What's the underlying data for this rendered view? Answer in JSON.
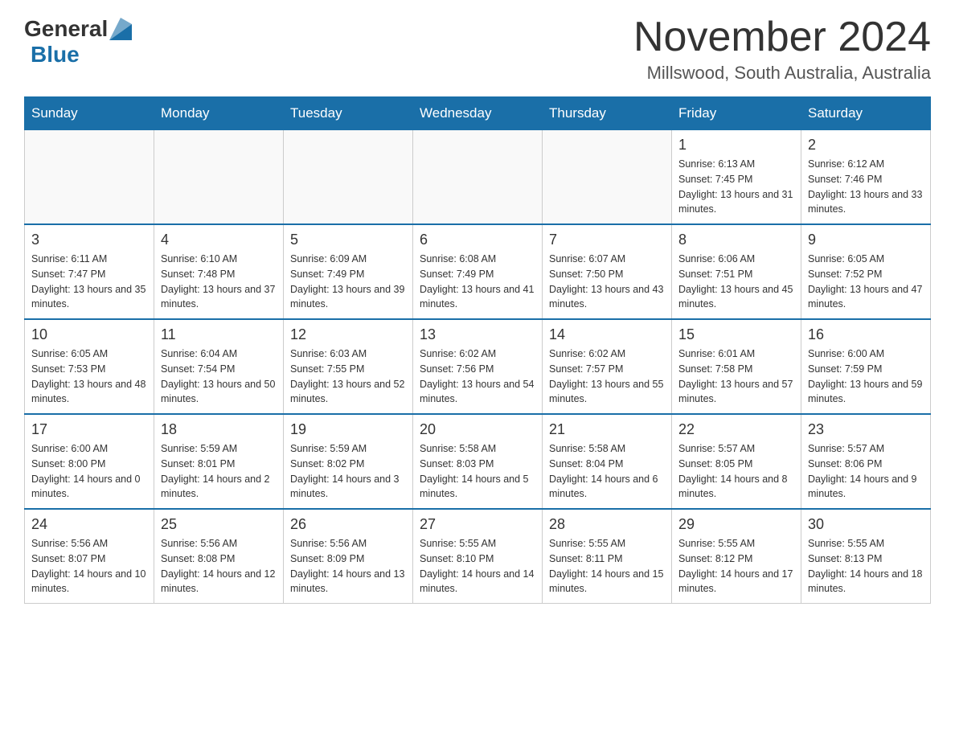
{
  "header": {
    "logo_general": "General",
    "logo_blue": "Blue",
    "month_title": "November 2024",
    "location": "Millswood, South Australia, Australia"
  },
  "weekdays": [
    "Sunday",
    "Monday",
    "Tuesday",
    "Wednesday",
    "Thursday",
    "Friday",
    "Saturday"
  ],
  "weeks": [
    [
      {
        "day": "",
        "sunrise": "",
        "sunset": "",
        "daylight": ""
      },
      {
        "day": "",
        "sunrise": "",
        "sunset": "",
        "daylight": ""
      },
      {
        "day": "",
        "sunrise": "",
        "sunset": "",
        "daylight": ""
      },
      {
        "day": "",
        "sunrise": "",
        "sunset": "",
        "daylight": ""
      },
      {
        "day": "",
        "sunrise": "",
        "sunset": "",
        "daylight": ""
      },
      {
        "day": "1",
        "sunrise": "Sunrise: 6:13 AM",
        "sunset": "Sunset: 7:45 PM",
        "daylight": "Daylight: 13 hours and 31 minutes."
      },
      {
        "day": "2",
        "sunrise": "Sunrise: 6:12 AM",
        "sunset": "Sunset: 7:46 PM",
        "daylight": "Daylight: 13 hours and 33 minutes."
      }
    ],
    [
      {
        "day": "3",
        "sunrise": "Sunrise: 6:11 AM",
        "sunset": "Sunset: 7:47 PM",
        "daylight": "Daylight: 13 hours and 35 minutes."
      },
      {
        "day": "4",
        "sunrise": "Sunrise: 6:10 AM",
        "sunset": "Sunset: 7:48 PM",
        "daylight": "Daylight: 13 hours and 37 minutes."
      },
      {
        "day": "5",
        "sunrise": "Sunrise: 6:09 AM",
        "sunset": "Sunset: 7:49 PM",
        "daylight": "Daylight: 13 hours and 39 minutes."
      },
      {
        "day": "6",
        "sunrise": "Sunrise: 6:08 AM",
        "sunset": "Sunset: 7:49 PM",
        "daylight": "Daylight: 13 hours and 41 minutes."
      },
      {
        "day": "7",
        "sunrise": "Sunrise: 6:07 AM",
        "sunset": "Sunset: 7:50 PM",
        "daylight": "Daylight: 13 hours and 43 minutes."
      },
      {
        "day": "8",
        "sunrise": "Sunrise: 6:06 AM",
        "sunset": "Sunset: 7:51 PM",
        "daylight": "Daylight: 13 hours and 45 minutes."
      },
      {
        "day": "9",
        "sunrise": "Sunrise: 6:05 AM",
        "sunset": "Sunset: 7:52 PM",
        "daylight": "Daylight: 13 hours and 47 minutes."
      }
    ],
    [
      {
        "day": "10",
        "sunrise": "Sunrise: 6:05 AM",
        "sunset": "Sunset: 7:53 PM",
        "daylight": "Daylight: 13 hours and 48 minutes."
      },
      {
        "day": "11",
        "sunrise": "Sunrise: 6:04 AM",
        "sunset": "Sunset: 7:54 PM",
        "daylight": "Daylight: 13 hours and 50 minutes."
      },
      {
        "day": "12",
        "sunrise": "Sunrise: 6:03 AM",
        "sunset": "Sunset: 7:55 PM",
        "daylight": "Daylight: 13 hours and 52 minutes."
      },
      {
        "day": "13",
        "sunrise": "Sunrise: 6:02 AM",
        "sunset": "Sunset: 7:56 PM",
        "daylight": "Daylight: 13 hours and 54 minutes."
      },
      {
        "day": "14",
        "sunrise": "Sunrise: 6:02 AM",
        "sunset": "Sunset: 7:57 PM",
        "daylight": "Daylight: 13 hours and 55 minutes."
      },
      {
        "day": "15",
        "sunrise": "Sunrise: 6:01 AM",
        "sunset": "Sunset: 7:58 PM",
        "daylight": "Daylight: 13 hours and 57 minutes."
      },
      {
        "day": "16",
        "sunrise": "Sunrise: 6:00 AM",
        "sunset": "Sunset: 7:59 PM",
        "daylight": "Daylight: 13 hours and 59 minutes."
      }
    ],
    [
      {
        "day": "17",
        "sunrise": "Sunrise: 6:00 AM",
        "sunset": "Sunset: 8:00 PM",
        "daylight": "Daylight: 14 hours and 0 minutes."
      },
      {
        "day": "18",
        "sunrise": "Sunrise: 5:59 AM",
        "sunset": "Sunset: 8:01 PM",
        "daylight": "Daylight: 14 hours and 2 minutes."
      },
      {
        "day": "19",
        "sunrise": "Sunrise: 5:59 AM",
        "sunset": "Sunset: 8:02 PM",
        "daylight": "Daylight: 14 hours and 3 minutes."
      },
      {
        "day": "20",
        "sunrise": "Sunrise: 5:58 AM",
        "sunset": "Sunset: 8:03 PM",
        "daylight": "Daylight: 14 hours and 5 minutes."
      },
      {
        "day": "21",
        "sunrise": "Sunrise: 5:58 AM",
        "sunset": "Sunset: 8:04 PM",
        "daylight": "Daylight: 14 hours and 6 minutes."
      },
      {
        "day": "22",
        "sunrise": "Sunrise: 5:57 AM",
        "sunset": "Sunset: 8:05 PM",
        "daylight": "Daylight: 14 hours and 8 minutes."
      },
      {
        "day": "23",
        "sunrise": "Sunrise: 5:57 AM",
        "sunset": "Sunset: 8:06 PM",
        "daylight": "Daylight: 14 hours and 9 minutes."
      }
    ],
    [
      {
        "day": "24",
        "sunrise": "Sunrise: 5:56 AM",
        "sunset": "Sunset: 8:07 PM",
        "daylight": "Daylight: 14 hours and 10 minutes."
      },
      {
        "day": "25",
        "sunrise": "Sunrise: 5:56 AM",
        "sunset": "Sunset: 8:08 PM",
        "daylight": "Daylight: 14 hours and 12 minutes."
      },
      {
        "day": "26",
        "sunrise": "Sunrise: 5:56 AM",
        "sunset": "Sunset: 8:09 PM",
        "daylight": "Daylight: 14 hours and 13 minutes."
      },
      {
        "day": "27",
        "sunrise": "Sunrise: 5:55 AM",
        "sunset": "Sunset: 8:10 PM",
        "daylight": "Daylight: 14 hours and 14 minutes."
      },
      {
        "day": "28",
        "sunrise": "Sunrise: 5:55 AM",
        "sunset": "Sunset: 8:11 PM",
        "daylight": "Daylight: 14 hours and 15 minutes."
      },
      {
        "day": "29",
        "sunrise": "Sunrise: 5:55 AM",
        "sunset": "Sunset: 8:12 PM",
        "daylight": "Daylight: 14 hours and 17 minutes."
      },
      {
        "day": "30",
        "sunrise": "Sunrise: 5:55 AM",
        "sunset": "Sunset: 8:13 PM",
        "daylight": "Daylight: 14 hours and 18 minutes."
      }
    ]
  ]
}
